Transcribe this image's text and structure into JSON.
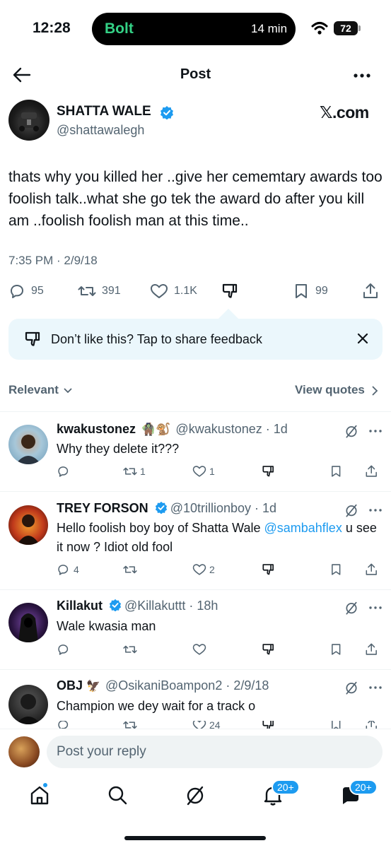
{
  "status": {
    "time": "12:28",
    "app": "Bolt",
    "eta": "14 min",
    "battery": "72"
  },
  "header": {
    "title": "Post"
  },
  "post": {
    "name": "SHATTA WALE",
    "handle": "@shattawalegh",
    "source": "𝕏.com",
    "text": "thats why you killed her ..give her cememtary awards too foolish talk..what she go tek the award do after you kill am ..foolish foolish man at this time..",
    "timestamp": "7:35 PM · 2/9/18",
    "replies": "95",
    "reposts": "391",
    "likes": "1.1K",
    "bookmarks": "99"
  },
  "feedback": {
    "text": "Don’t like this? Tap to share feedback"
  },
  "sort": {
    "label": "Relevant",
    "view_quotes": "View quotes"
  },
  "replies": [
    {
      "name": "kwakustonez",
      "emoji": "🧌🐒",
      "handle": "@kwakustonez · 1d",
      "text": "Why they delete it???",
      "reply_count": "",
      "repost_count": "1",
      "like_count": "1"
    },
    {
      "name": "TREY FORSON",
      "handle": "@10trillionboy · 1d",
      "text_before": "Hello foolish boy boy of Shatta Wale ",
      "mention": "@sambahflex",
      "text_after": "u see it now ? Idiot old fool",
      "reply_count": "4",
      "repost_count": "",
      "like_count": "2"
    },
    {
      "name": "Killakut",
      "handle": "@Killakuttt · 18h",
      "text": "Wale kwasia man",
      "reply_count": "",
      "repost_count": "",
      "like_count": ""
    },
    {
      "name": "OBJ",
      "emoji": "🦅",
      "handle": "@OsikaniBoampon2 · 2/9/18",
      "text": "Champion we dey wait for a track o",
      "like_count": "24"
    }
  ],
  "reply_bar": {
    "placeholder": "Post your reply"
  },
  "tabs": {
    "notifications_badge": "20+",
    "messages_badge": "20+"
  },
  "colors": {
    "accent": "#1d9bf0",
    "feedback_bg": "#ebf7fc",
    "muted": "#536471"
  }
}
